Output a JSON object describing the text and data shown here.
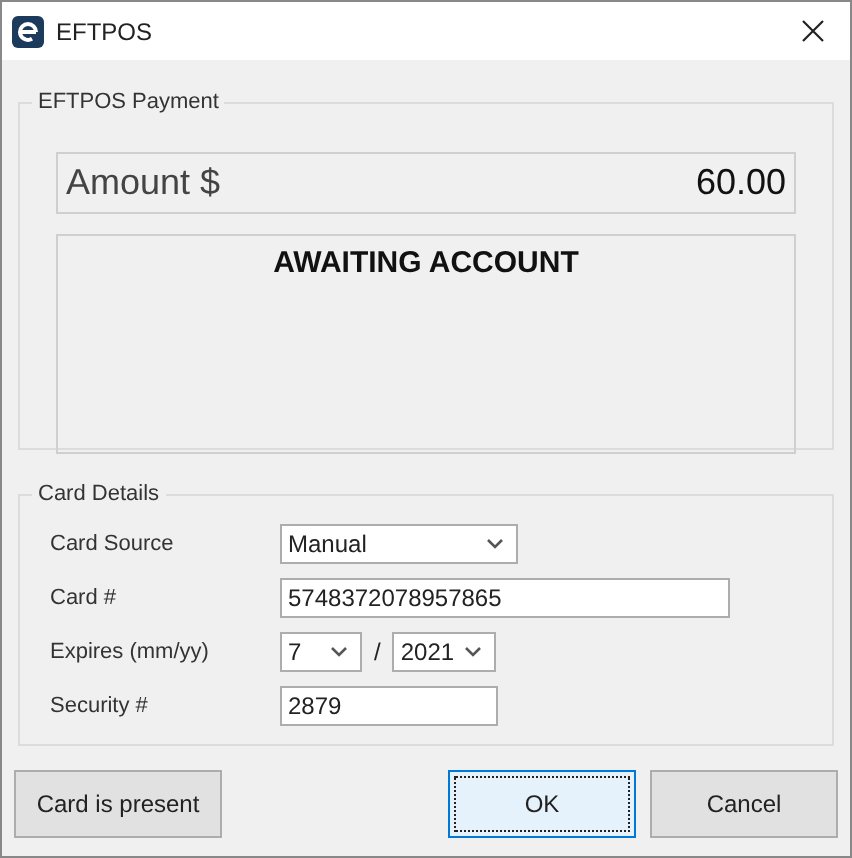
{
  "window": {
    "title": "EFTPOS"
  },
  "payment": {
    "legend": "EFTPOS Payment",
    "amount_label": "Amount $",
    "amount": "60.00",
    "status": "AWAITING ACCOUNT"
  },
  "card_details": {
    "legend": "Card Details",
    "fields": [
      {
        "kind": "select",
        "label": "Card Source",
        "value": "Manual"
      },
      {
        "kind": "text",
        "label": "Card #",
        "value": "5748372078957865"
      },
      {
        "kind": "expiry",
        "label": "Expires (mm/yy)",
        "month": "7",
        "separator": "/",
        "year": "2021"
      },
      {
        "kind": "short",
        "label": "Security #",
        "value": "2879"
      }
    ]
  },
  "buttons": [
    {
      "label": "Card is present",
      "focused": false
    },
    {
      "label": "OK",
      "focused": true
    },
    {
      "label": "Cancel",
      "focused": false
    }
  ]
}
